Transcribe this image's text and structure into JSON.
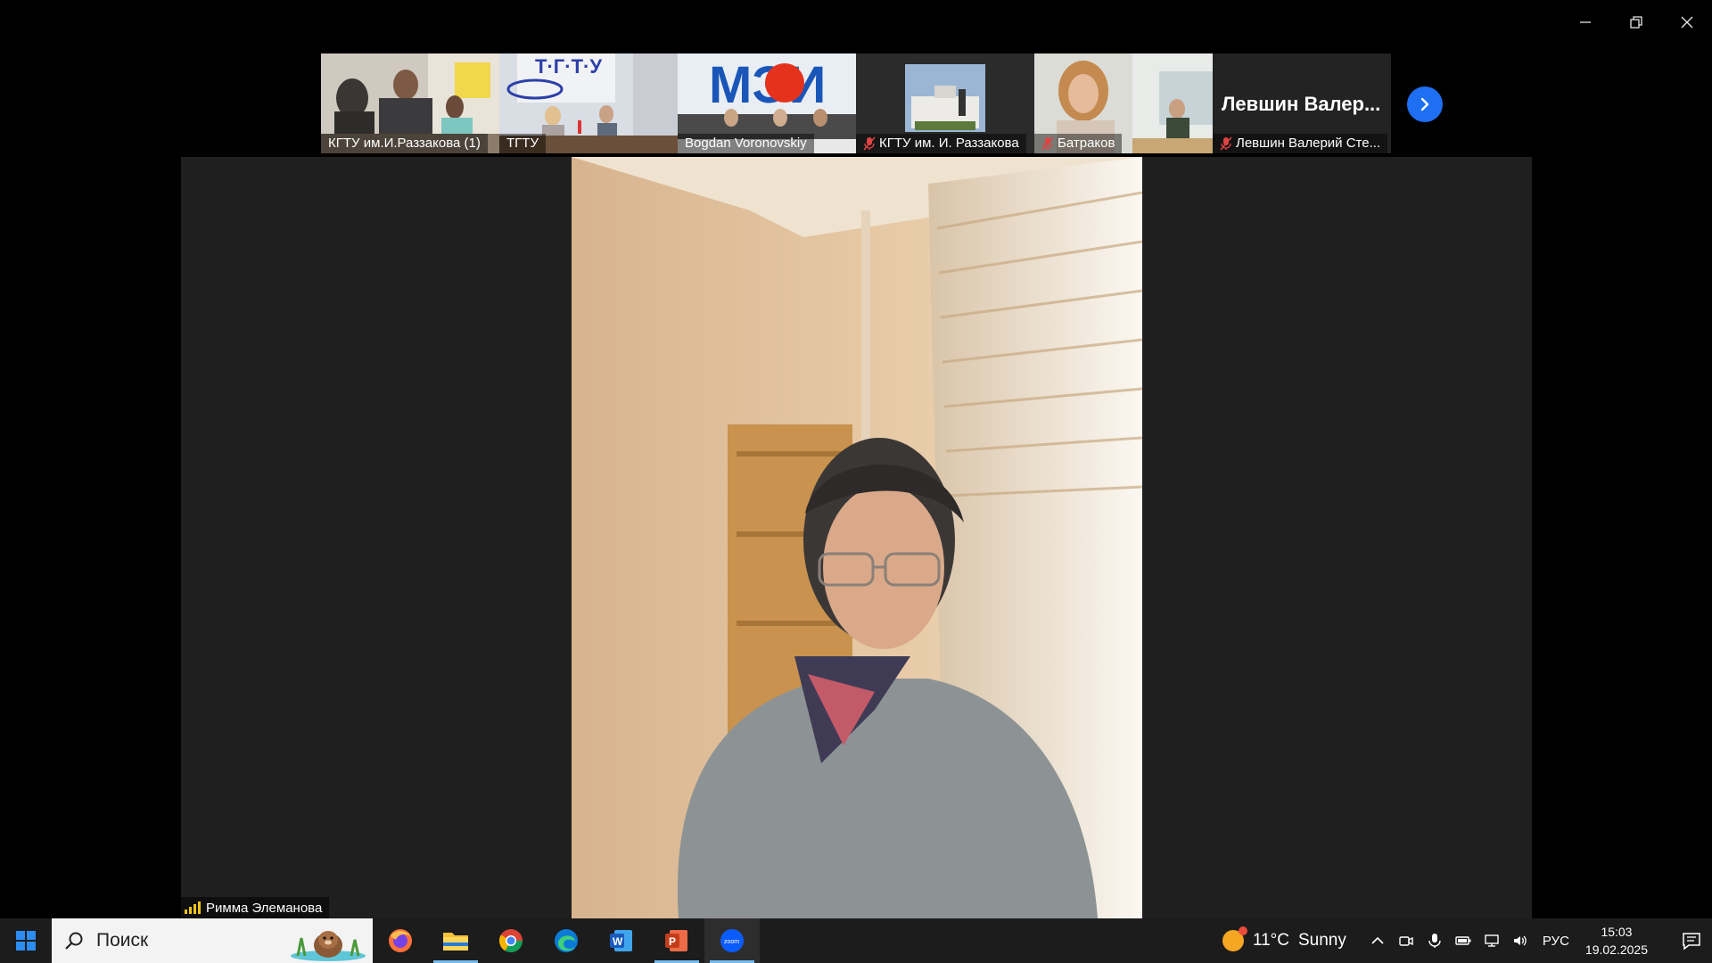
{
  "window": {
    "controls": [
      "minimize",
      "restore",
      "close"
    ]
  },
  "thumbnails": [
    {
      "label": "КГТУ им.И.Раззакова (1)",
      "muted": false
    },
    {
      "label": "ТГТУ",
      "muted": false
    },
    {
      "label": "Bogdan Voronovskiy",
      "muted": false
    },
    {
      "label": "КГТУ им. И. Раззакова",
      "muted": true
    },
    {
      "label": "Батраков",
      "muted": true
    },
    {
      "label": "Левшин Валерий Сте...",
      "muted": true,
      "big_name": "Левшин  Валер..."
    }
  ],
  "stage": {
    "speaker_name": "Римма Элеманова"
  },
  "taskbar": {
    "search_placeholder": "Поиск",
    "apps": [
      "firefox-icon",
      "file-explorer-icon",
      "chrome-icon",
      "edge-icon",
      "word-icon",
      "powerpoint-icon",
      "zoom-icon"
    ],
    "weather": {
      "temp": "11°C",
      "condition": "Sunny"
    },
    "language": "РУС",
    "time": "15:03",
    "date": "19.02.2025"
  },
  "colors": {
    "accent": "#1e6ff2",
    "stage_bg": "#1f1f1f",
    "taskbar_bg": "#1c1c1c"
  }
}
